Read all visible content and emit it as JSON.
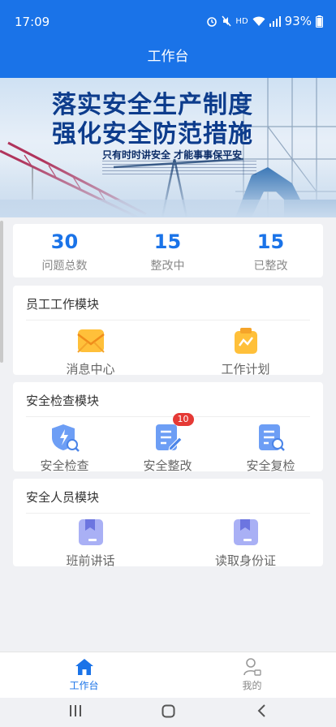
{
  "status": {
    "time": "17:09",
    "hd": "HD",
    "battery": "93%"
  },
  "header": {
    "title": "工作台"
  },
  "banner": {
    "line1": "落实安全生产制度",
    "line2": "强化安全防范措施",
    "slogan": "只有时时讲安全  才能事事保平安"
  },
  "stats": [
    {
      "value": "30",
      "label": "问题总数"
    },
    {
      "value": "15",
      "label": "整改中"
    },
    {
      "value": "15",
      "label": "已整改"
    }
  ],
  "modules": {
    "employee": {
      "title": "员工工作模块",
      "items": [
        {
          "label": "消息中心",
          "icon": "mail-icon"
        },
        {
          "label": "工作计划",
          "icon": "plan-icon"
        }
      ]
    },
    "inspection": {
      "title": "安全检查模块",
      "items": [
        {
          "label": "安全检查",
          "icon": "shield-search-icon"
        },
        {
          "label": "安全整改",
          "icon": "edit-document-icon",
          "badge": "10"
        },
        {
          "label": "安全复检",
          "icon": "document-search-icon"
        }
      ]
    },
    "personnel": {
      "title": "安全人员模块",
      "items": [
        {
          "label": "班前讲话",
          "icon": "bookmark-card-icon"
        },
        {
          "label": "读取身份证",
          "icon": "bookmark-card-icon"
        }
      ]
    }
  },
  "tabbar": {
    "items": [
      {
        "label": "工作台",
        "icon": "home-icon",
        "active": true
      },
      {
        "label": "我的",
        "icon": "user-icon",
        "active": false
      }
    ]
  },
  "colors": {
    "primary": "#1a73e8",
    "badge": "#e53935",
    "muted": "#888888"
  }
}
